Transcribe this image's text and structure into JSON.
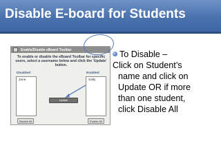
{
  "slide": {
    "title": "Disable E-board for Students",
    "bullet": "To Disable –",
    "body_lines": [
      "Click on Student’s",
      "name and click on",
      "Update OR if more",
      "than one student,",
      "click Disable All"
    ]
  },
  "screenshot": {
    "window_title": "Enable/Disable eBoard Toolbar",
    "instructions": "To enable or disable the eBoard Toolbar for specific users, select a username below and click the 'Update' button.",
    "disabled_label": "Disabled",
    "enabled_label": "Enabled",
    "disabled_items": [
      "Jane"
    ],
    "enabled_items": [
      "Sally"
    ],
    "update_button": "Update",
    "disable_all_button": "Disable All",
    "enable_all_button": "Enable All"
  },
  "colors": {
    "title_bar": "#4a72ad",
    "title_text": "#ffffff",
    "bullet": "#5b86c4",
    "highlight_circle": "#5577b8"
  }
}
